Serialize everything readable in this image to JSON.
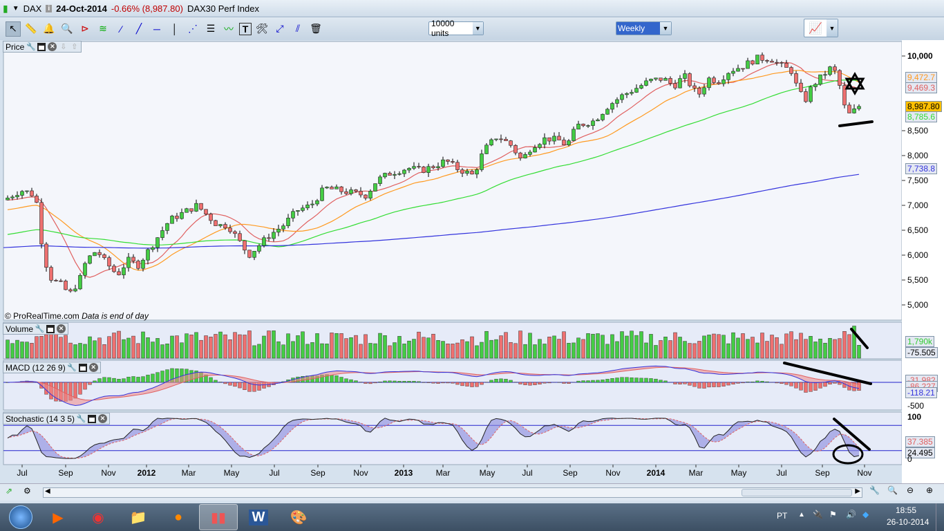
{
  "window": {
    "symbol": "DAX",
    "date": "24-Oct-2014",
    "change": "-0.66% (8,987.80)",
    "name": "DAX30 Perf Index",
    "info_icon": "info-icon",
    "change_color": "#c00000"
  },
  "toolbar": {
    "tools": [
      "pointer-icon",
      "ruler-icon",
      "alert-bell-icon",
      "zoom-magnifier-icon",
      "triangle-pattern-icon",
      "channel-icon",
      "segment-icon",
      "line-icon",
      "horizontal-line-icon",
      "vertical-line-icon",
      "fan-icon",
      "fibonacci-icon",
      "trend-channel-icon",
      "text-icon",
      "tools-icon",
      "resize-icon",
      "parallel-line-icon",
      "trash-icon"
    ],
    "units": "10000 units",
    "timeframe": "Weekly",
    "indicators_button": "indicators-icon"
  },
  "panels": {
    "price": {
      "title": "Price",
      "footer_copy": "© ProRealTime.com",
      "footer_note": "Data is end of day",
      "axis": [
        "10,000",
        "8,500",
        "8,000",
        "7,500",
        "7,000",
        "6,500",
        "6,000",
        "5,500",
        "5,000"
      ],
      "labels": [
        {
          "text": "9,472.7",
          "color": "#ff9a20"
        },
        {
          "text": "9,469.3",
          "color": "#e06060"
        },
        {
          "text": "8,987.80",
          "color": "#000000",
          "bg": "#ffc000"
        },
        {
          "text": "8,785.6",
          "color": "#33dd33"
        },
        {
          "text": "7,738.8",
          "color": "#3333dd"
        }
      ]
    },
    "volume": {
      "title": "Volume",
      "labels": [
        {
          "text": "1,790k",
          "color": "#33cc33"
        },
        {
          "text": "-75.505",
          "color": "#000000"
        }
      ]
    },
    "macd": {
      "title": "MACD (12 26 9)",
      "labels": [
        {
          "text": "-31.982",
          "color": "#e06060"
        },
        {
          "text": "-86.227",
          "color": "#e06060"
        },
        {
          "text": "-118.21",
          "color": "#3333dd"
        }
      ],
      "axis": [
        "-500"
      ]
    },
    "stochastic": {
      "title": "Stochastic (14 3 5)",
      "axis": [
        "100",
        "0"
      ],
      "labels": [
        {
          "text": "37.385",
          "color": "#e06060"
        },
        {
          "text": "24.495",
          "color": "#000000"
        }
      ]
    }
  },
  "xaxis": [
    "Jul",
    "Sep",
    "Nov",
    "2012",
    "Mar",
    "May",
    "Jul",
    "Sep",
    "Nov",
    "2013",
    "Mar",
    "May",
    "Jul",
    "Sep",
    "Nov",
    "2014",
    "Mar",
    "May",
    "Jul",
    "Sep",
    "Nov"
  ],
  "chart_data": {
    "type": "candlestick",
    "timeframe": "weekly",
    "x_start": "2011-07-01",
    "x_end": "2014-11-01",
    "ylim": [
      5000,
      10000
    ],
    "moving_averages_colors": [
      "#e06060",
      "#ff9a20",
      "#33dd33",
      "#3333dd"
    ],
    "price_anchors": [
      [
        "2011-06-10",
        7150
      ],
      [
        "2011-06-29",
        7300
      ],
      [
        "2011-07-14",
        7250
      ],
      [
        "2011-07-24",
        7000
      ],
      [
        "2011-07-31",
        6000
      ],
      [
        "2011-08-13",
        5500
      ],
      [
        "2011-08-28",
        5400
      ],
      [
        "2011-09-07",
        5200
      ],
      [
        "2011-09-22",
        5500
      ],
      [
        "2011-10-02",
        5900
      ],
      [
        "2011-10-17",
        6100
      ],
      [
        "2011-10-27",
        5900
      ],
      [
        "2011-11-16",
        5600
      ],
      [
        "2011-12-01",
        5900
      ],
      [
        "2011-12-16",
        5800
      ],
      [
        "2011-12-31",
        6100
      ],
      [
        "2012-01-15",
        6400
      ],
      [
        "2012-01-30",
        6700
      ],
      [
        "2012-02-19",
        6850
      ],
      [
        "2012-03-10",
        7000
      ],
      [
        "2012-03-25",
        6800
      ],
      [
        "2012-04-09",
        6600
      ],
      [
        "2012-04-24",
        6600
      ],
      [
        "2012-05-09",
        6300
      ],
      [
        "2012-05-24",
        6000
      ],
      [
        "2012-06-08",
        6200
      ],
      [
        "2012-06-23",
        6400
      ],
      [
        "2012-07-13",
        6600
      ],
      [
        "2012-08-02",
        6900
      ],
      [
        "2012-08-22",
        7000
      ],
      [
        "2012-09-11",
        7350
      ],
      [
        "2012-10-01",
        7300
      ],
      [
        "2012-10-21",
        7250
      ],
      [
        "2012-11-10",
        7200
      ],
      [
        "2012-11-25",
        7500
      ],
      [
        "2012-12-15",
        7650
      ],
      [
        "2013-01-09",
        7750
      ],
      [
        "2013-01-29",
        7700
      ],
      [
        "2013-02-18",
        7800
      ],
      [
        "2013-03-05",
        7900
      ],
      [
        "2013-03-20",
        7750
      ],
      [
        "2013-04-14",
        7600
      ],
      [
        "2013-04-29",
        8100
      ],
      [
        "2013-05-19",
        8400
      ],
      [
        "2013-06-08",
        8200
      ],
      [
        "2013-06-23",
        7900
      ],
      [
        "2013-07-08",
        8200
      ],
      [
        "2013-07-28",
        8350
      ],
      [
        "2013-08-17",
        8300
      ],
      [
        "2013-08-27",
        8200
      ],
      [
        "2013-09-11",
        8600
      ],
      [
        "2013-10-06",
        8700
      ],
      [
        "2013-10-26",
        9000
      ],
      [
        "2013-11-15",
        9200
      ],
      [
        "2013-12-05",
        9350
      ],
      [
        "2013-12-25",
        9500
      ],
      [
        "2014-01-14",
        9550
      ],
      [
        "2014-01-29",
        9400
      ],
      [
        "2014-02-13",
        9600
      ],
      [
        "2014-03-05",
        9200
      ],
      [
        "2014-03-20",
        9550
      ],
      [
        "2014-04-04",
        9500
      ],
      [
        "2014-04-19",
        9700
      ],
      [
        "2014-05-09",
        9800
      ],
      [
        "2014-05-29",
        9950
      ],
      [
        "2014-06-18",
        9950
      ],
      [
        "2014-07-03",
        9800
      ],
      [
        "2014-07-18",
        9700
      ],
      [
        "2014-07-28",
        9300
      ],
      [
        "2014-08-07",
        9100
      ],
      [
        "2014-08-17",
        9400
      ],
      [
        "2014-09-01",
        9600
      ],
      [
        "2014-09-16",
        9800
      ],
      [
        "2014-09-26",
        9400
      ],
      [
        "2014-10-06",
        8800
      ],
      [
        "2014-10-13",
        8850
      ],
      [
        "2014-10-24",
        8987.8
      ]
    ]
  },
  "statusbar": {
    "icons": [
      "scale-icon",
      "settings-icon",
      "chart-settings-icon",
      "zoom-fit-icon",
      "zoom-out-icon",
      "zoom-in-icon"
    ]
  },
  "taskbar": {
    "apps": [
      "media-player-icon",
      "chrome-icon",
      "explorer-icon",
      "firefox-icon",
      "prorealtime-icon",
      "word-icon",
      "paint-icon"
    ],
    "lang": "PT",
    "time": "18:55",
    "date": "26-10-2014"
  }
}
